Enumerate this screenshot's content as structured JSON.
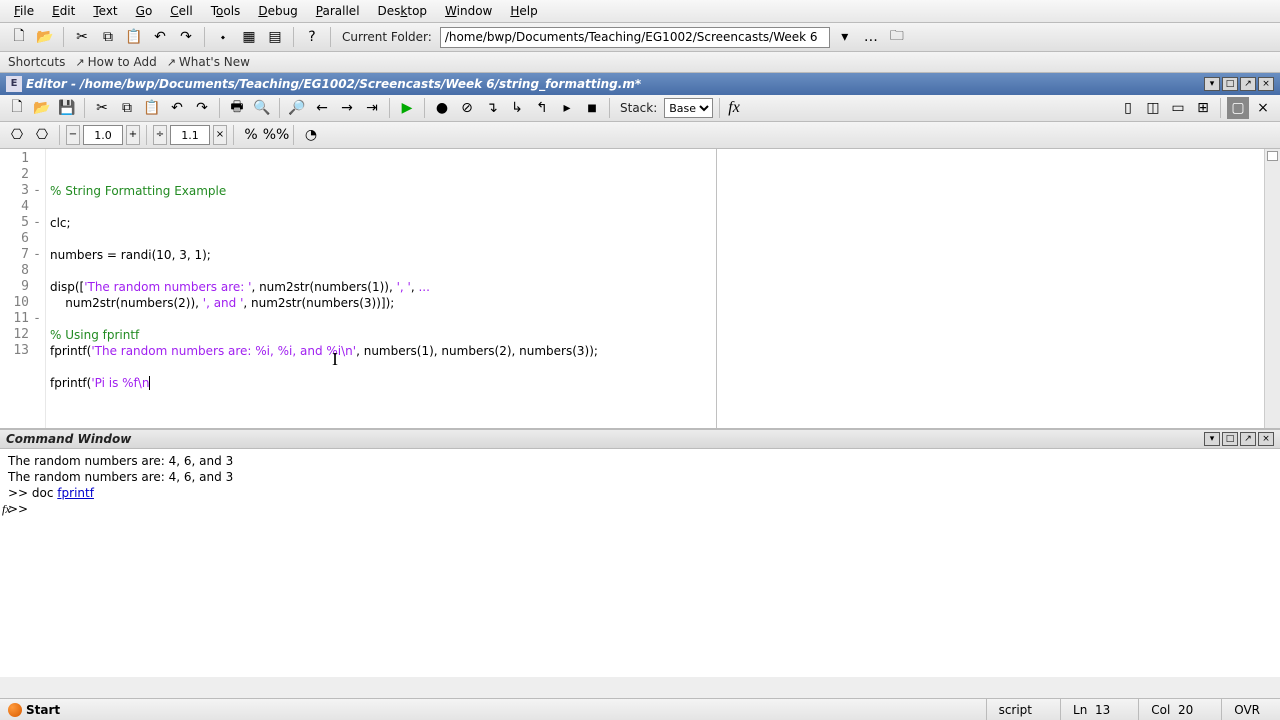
{
  "menu": {
    "items": [
      "File",
      "Edit",
      "Text",
      "Go",
      "Cell",
      "Tools",
      "Debug",
      "Parallel",
      "Desktop",
      "Window",
      "Help"
    ]
  },
  "main_toolbar": {
    "current_folder_label": "Current Folder:",
    "folder_path": "/home/bwp/Documents/Teaching/EG1002/Screencasts/Week 6"
  },
  "shortcuts": {
    "label": "Shortcuts",
    "how_to_add": "How to Add",
    "whats_new": "What's New"
  },
  "editor": {
    "title": "Editor - /home/bwp/Documents/Teaching/EG1002/Screencasts/Week 6/string_formatting.m*",
    "stack_label": "Stack:",
    "stack_value": "Base",
    "num1": "1.0",
    "num2": "1.1",
    "times": "×",
    "code_lines": [
      {
        "n": "1",
        "dash": false,
        "html": "<span class='c'>% String Formatting Example</span>"
      },
      {
        "n": "2",
        "dash": false,
        "html": ""
      },
      {
        "n": "3",
        "dash": true,
        "html": "clc;"
      },
      {
        "n": "4",
        "dash": false,
        "html": ""
      },
      {
        "n": "5",
        "dash": true,
        "html": "numbers = randi(10, 3, 1);"
      },
      {
        "n": "6",
        "dash": false,
        "html": ""
      },
      {
        "n": "7",
        "dash": true,
        "html": "disp([<span class='s'>'The random numbers are: '</span>, num2str(numbers(1)), <span class='s'>', '</span>, <span class='s'>...</span>"
      },
      {
        "n": "8",
        "dash": false,
        "html": "    num2str(numbers(2)), <span class='s'>', and '</span>, num2str(numbers(3))]);"
      },
      {
        "n": "9",
        "dash": false,
        "html": ""
      },
      {
        "n": "10",
        "dash": false,
        "html": "<span class='c'>% Using fprintf</span>"
      },
      {
        "n": "11",
        "dash": true,
        "html": "fprintf(<span class='s'>'The random numbers are: %i, %i, and %i\\n'</span>, numbers(1), numbers(2), numbers(3));"
      },
      {
        "n": "12",
        "dash": false,
        "html": ""
      },
      {
        "n": "13",
        "dash": false,
        "html": "fprintf(<span class='s'>'Pi is %f\\n</span><span class='cursor'></span>"
      }
    ]
  },
  "command_window": {
    "title": "Command Window",
    "lines": [
      "The random numbers are: 4, 6, and 3",
      "The random numbers are: 4, 6, and 3",
      ">> doc <a class='hl'>fprintf</a>",
      ">> "
    ]
  },
  "status": {
    "start": "Start",
    "mode": "script",
    "ln_label": "Ln",
    "ln": "13",
    "col_label": "Col",
    "col": "20",
    "ovr": "OVR"
  }
}
